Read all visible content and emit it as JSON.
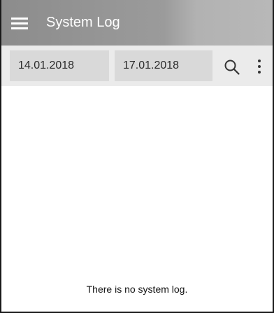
{
  "app_bar": {
    "title": "System Log",
    "menu_icon": "hamburger-menu-icon"
  },
  "filters": {
    "date_from": "14.01.2018",
    "date_to": "17.01.2018",
    "search_icon": "search-icon",
    "more_icon": "more-vert-icon"
  },
  "content": {
    "empty_message": "There is no system log."
  },
  "colors": {
    "app_bar": "#9b9b9b",
    "toolbar": "#ebebeb",
    "field": "#d9d9d9",
    "text": "#2a2a2a"
  }
}
